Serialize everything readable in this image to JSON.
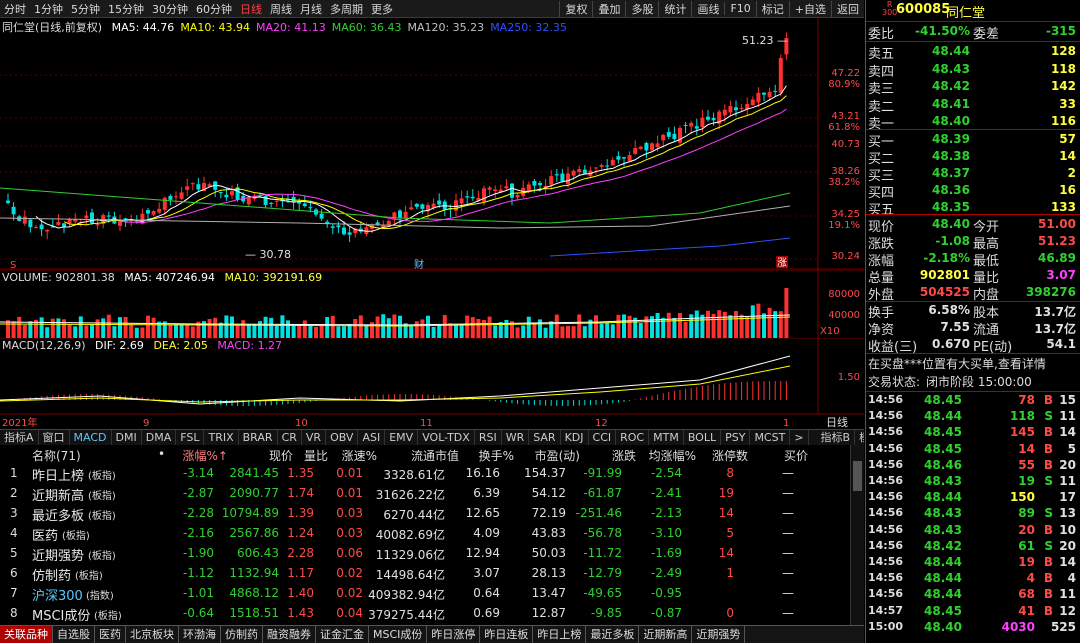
{
  "toolbar": {
    "periods": [
      "分时",
      "1分钟",
      "5分钟",
      "15分钟",
      "30分钟",
      "60分钟",
      "日线",
      "周线",
      "月线",
      "多周期",
      "更多"
    ],
    "active_period": "日线",
    "right": [
      "复权",
      "叠加",
      "多股",
      "统计",
      "画线",
      "F10",
      "标记",
      "+自选",
      "返回"
    ]
  },
  "main": {
    "title": "同仁堂(日线,前复权)",
    "ma": [
      {
        "label": "MA5: 44.76",
        "color": "#ffffff"
      },
      {
        "label": "MA10: 43.94",
        "color": "#ffff00"
      },
      {
        "label": "MA20: 41.13",
        "color": "#ff40ff"
      },
      {
        "label": "MA60: 36.43",
        "color": "#30d030"
      },
      {
        "label": "MA120: 35.23",
        "color": "#c0c0c0"
      },
      {
        "label": "MA250: 32.35",
        "color": "#3050ff"
      }
    ],
    "price_labels": [
      {
        "price": "47.22",
        "pct": "80.9%"
      },
      {
        "price": "43.21",
        "pct": "61.8%"
      },
      {
        "price": "40.73",
        "pct": ""
      },
      {
        "price": "38.26",
        "pct": "38.2%"
      },
      {
        "price": "34.25",
        "pct": "19.1%"
      },
      {
        "price": "30.24",
        "pct": ""
      }
    ],
    "high_label": "51.23",
    "low_label": "30.78",
    "marker_cai": "财",
    "marker_zhang": "涨",
    "marker_s": "S"
  },
  "volume": {
    "title": "VOLUME: 902801.38",
    "ma5": "MA5: 407246.94",
    "ma10": "MA10: 392191.69",
    "axis": [
      "80000",
      "40000"
    ],
    "unit": "X10"
  },
  "macd": {
    "title": "MACD(12,26,9)",
    "dif": "DIF: 2.69",
    "dea": "DEA: 2.05",
    "macd": "MACD: 1.27",
    "axis": "1.50"
  },
  "dates": [
    "2021年",
    "9",
    "10",
    "11",
    "12",
    "1"
  ],
  "date_right": "日线",
  "date_ctrl": [
    "+",
    "-"
  ],
  "ind_tabs": [
    "指标A",
    "窗口",
    "MACD",
    "DMI",
    "DMA",
    "FSL",
    "TRIX",
    "BRAR",
    "CR",
    "VR",
    "OBV",
    "ASI",
    "EMV",
    "VOL-TDX",
    "RSI",
    "WR",
    "SAR",
    "KDJ",
    "CCI",
    "ROC",
    "MTM",
    "BOLL",
    "PSY",
    "MCST",
    ">"
  ],
  "ind_active": "MACD",
  "ind_right": [
    "指标B",
    "模",
    "板"
  ],
  "table": {
    "headers": [
      "名称(71)",
      "•",
      "涨幅%↑",
      "现价",
      "量比",
      "涨速%",
      "流通市值",
      "换手%",
      "市盈(动)",
      "涨跌",
      "均涨幅%",
      "涨停数",
      "买价"
    ],
    "rows": [
      {
        "no": "1",
        "name": "昨日上榜",
        "tag": "(板指)",
        "pct": "-3.14",
        "price": "2841.45",
        "vr": "1.35",
        "spd": "0.01",
        "mv": "3328.61亿",
        "turn": "16.16",
        "pe": "154.37",
        "chg": "-91.99",
        "avg": "-2.54",
        "zt": "8",
        "bid": "—",
        "ntype": "w"
      },
      {
        "no": "2",
        "name": "近期新高",
        "tag": "(板指)",
        "pct": "-2.87",
        "price": "2090.77",
        "vr": "1.74",
        "spd": "0.01",
        "mv": "31626.22亿",
        "turn": "6.39",
        "pe": "54.12",
        "chg": "-61.87",
        "avg": "-2.41",
        "zt": "19",
        "bid": "—",
        "ntype": "w"
      },
      {
        "no": "3",
        "name": "最近多板",
        "tag": "(板指)",
        "pct": "-2.28",
        "price": "10794.89",
        "vr": "1.39",
        "spd": "0.03",
        "mv": "6270.44亿",
        "turn": "12.65",
        "pe": "72.19",
        "chg": "-251.46",
        "avg": "-2.13",
        "zt": "14",
        "bid": "—",
        "ntype": "w"
      },
      {
        "no": "4",
        "name": "医药",
        "tag": "(板指)",
        "pct": "-2.16",
        "price": "2567.86",
        "vr": "1.24",
        "spd": "0.03",
        "mv": "40082.69亿",
        "turn": "4.09",
        "pe": "43.83",
        "chg": "-56.78",
        "avg": "-3.10",
        "zt": "5",
        "bid": "—",
        "ntype": "w"
      },
      {
        "no": "5",
        "name": "近期强势",
        "tag": "(板指)",
        "pct": "-1.90",
        "price": "606.43",
        "vr": "2.28",
        "spd": "0.06",
        "mv": "11329.06亿",
        "turn": "12.94",
        "pe": "50.03",
        "chg": "-11.72",
        "avg": "-1.69",
        "zt": "14",
        "bid": "—",
        "ntype": "w"
      },
      {
        "no": "6",
        "name": "仿制药",
        "tag": "(板指)",
        "pct": "-1.12",
        "price": "1132.94",
        "vr": "1.17",
        "spd": "0.02",
        "mv": "14498.64亿",
        "turn": "3.07",
        "pe": "28.13",
        "chg": "-12.79",
        "avg": "-2.49",
        "zt": "1",
        "bid": "—",
        "ntype": "w"
      },
      {
        "no": "7",
        "name": "沪深300",
        "tag": "(指数)",
        "pct": "-1.01",
        "price": "4868.12",
        "vr": "1.40",
        "spd": "0.02",
        "mv": "409382.94亿",
        "turn": "0.64",
        "pe": "13.47",
        "chg": "-49.65",
        "avg": "-0.95",
        "zt": "",
        "bid": "—",
        "ntype": "c"
      },
      {
        "no": "8",
        "name": "MSCI成份",
        "tag": "(板指)",
        "pct": "-0.64",
        "price": "1518.51",
        "vr": "1.43",
        "spd": "0.04",
        "mv": "379275.44亿",
        "turn": "0.69",
        "pe": "12.87",
        "chg": "-9.85",
        "avg": "-0.87",
        "zt": "0",
        "bid": "—",
        "ntype": "w"
      }
    ]
  },
  "bottom_tabs": [
    "关联品种",
    "自选股",
    "医药",
    "北京板块",
    "环渤海",
    "仿制药",
    "融资融券",
    "证金汇金",
    "MSCI成份",
    "昨日涨停",
    "昨日连板",
    "昨日上榜",
    "最近多板",
    "近期新高",
    "近期强势"
  ],
  "bottom_active": "关联品种",
  "right_panel": {
    "logo_top": "R",
    "logo_bottom": "300",
    "code": "600085",
    "name": "同仁堂",
    "weibi_label": "委比",
    "weibi": "-41.50%",
    "weicha_label": "委差",
    "weicha": "-315",
    "sell": [
      {
        "label": "卖五",
        "price": "48.44",
        "vol": "128"
      },
      {
        "label": "卖四",
        "price": "48.43",
        "vol": "118"
      },
      {
        "label": "卖三",
        "price": "48.42",
        "vol": "142"
      },
      {
        "label": "卖二",
        "price": "48.41",
        "vol": "33"
      },
      {
        "label": "卖一",
        "price": "48.40",
        "vol": "116"
      }
    ],
    "buy": [
      {
        "label": "买一",
        "price": "48.39",
        "vol": "57"
      },
      {
        "label": "买二",
        "price": "48.38",
        "vol": "14"
      },
      {
        "label": "买三",
        "price": "48.37",
        "vol": "2"
      },
      {
        "label": "买四",
        "price": "48.36",
        "vol": "16"
      },
      {
        "label": "买五",
        "price": "48.35",
        "vol": "133"
      }
    ],
    "quote": [
      {
        "l1": "现价",
        "v1": "48.40",
        "c1": "grn",
        "l2": "今开",
        "v2": "51.00",
        "c2": "red"
      },
      {
        "l1": "涨跌",
        "v1": "-1.08",
        "c1": "grn",
        "l2": "最高",
        "v2": "51.23",
        "c2": "red"
      },
      {
        "l1": "涨幅",
        "v1": "-2.18%",
        "c1": "grn",
        "l2": "最低",
        "v2": "46.89",
        "c2": "grn"
      },
      {
        "l1": "总量",
        "v1": "902801",
        "c1": "yel",
        "l2": "量比",
        "v2": "3.07",
        "c2": "mag"
      },
      {
        "l1": "外盘",
        "v1": "504525",
        "c1": "red",
        "l2": "内盘",
        "v2": "398276",
        "c2": "grn"
      }
    ],
    "quote2": [
      {
        "l1": "换手",
        "v1": "6.58%",
        "l2": "股本",
        "v2": "13.7亿"
      },
      {
        "l1": "净资",
        "v1": "7.55",
        "l2": "流通",
        "v2": "13.7亿"
      },
      {
        "l1": "收益(三)",
        "v1": "0.670",
        "l2": "PE(动)",
        "v2": "54.1"
      }
    ],
    "notice": "在买盘***位置有大买单,查看详情",
    "trade_status_label": "交易状态:",
    "trade_status": "闭市阶段 15:00:00",
    "ticks": [
      {
        "t": "14:56",
        "p": "48.45",
        "v": "78",
        "d": "B",
        "n": "15"
      },
      {
        "t": "14:56",
        "p": "48.44",
        "v": "118",
        "d": "S",
        "n": "11"
      },
      {
        "t": "14:56",
        "p": "48.45",
        "v": "145",
        "d": "B",
        "n": "14"
      },
      {
        "t": "14:56",
        "p": "48.45",
        "v": "14",
        "d": "B",
        "n": "5"
      },
      {
        "t": "14:56",
        "p": "48.46",
        "v": "55",
        "d": "B",
        "n": "20"
      },
      {
        "t": "14:56",
        "p": "48.43",
        "v": "19",
        "d": "S",
        "n": "11"
      },
      {
        "t": "14:56",
        "p": "48.44",
        "v": "150",
        "d": "",
        "n": "17"
      },
      {
        "t": "14:56",
        "p": "48.43",
        "v": "89",
        "d": "S",
        "n": "13"
      },
      {
        "t": "14:56",
        "p": "48.43",
        "v": "20",
        "d": "B",
        "n": "10"
      },
      {
        "t": "14:56",
        "p": "48.42",
        "v": "61",
        "d": "S",
        "n": "20"
      },
      {
        "t": "14:56",
        "p": "48.44",
        "v": "19",
        "d": "B",
        "n": "14"
      },
      {
        "t": "14:56",
        "p": "48.44",
        "v": "4",
        "d": "B",
        "n": "4"
      },
      {
        "t": "14:56",
        "p": "48.44",
        "v": "68",
        "d": "B",
        "n": "11"
      },
      {
        "t": "14:57",
        "p": "48.45",
        "v": "41",
        "d": "B",
        "n": "12"
      },
      {
        "t": "15:00",
        "p": "48.40",
        "v": "4030",
        "d": "",
        "n": "525"
      }
    ]
  }
}
